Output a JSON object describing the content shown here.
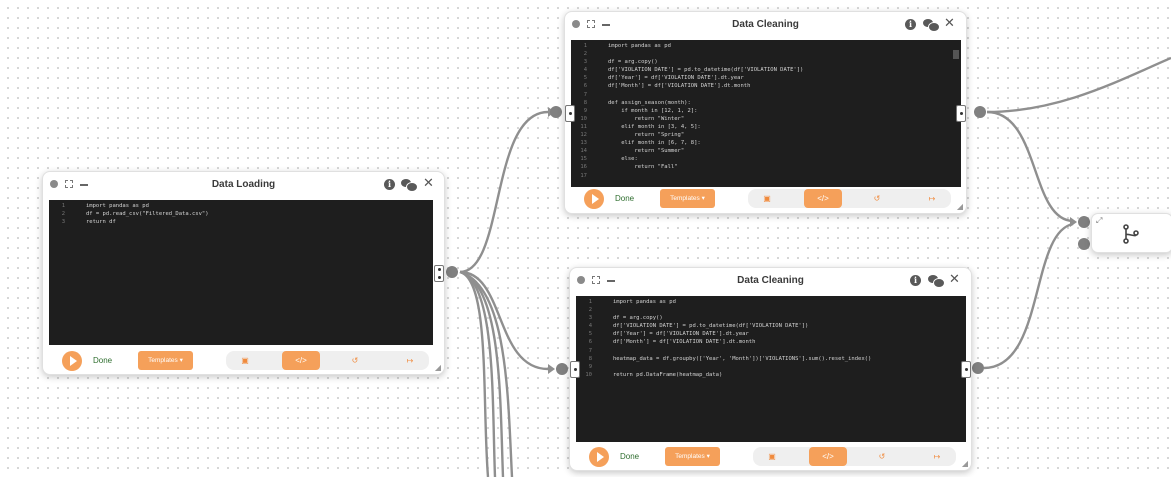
{
  "colors": {
    "accent": "#f5a05a",
    "status_done": "#2f6e2f",
    "editor_bg": "#1e1e1e"
  },
  "node_loading": {
    "title": "Data Loading",
    "status": "Done",
    "templates_label": "Templates ▾",
    "code": [
      {
        "n": "1",
        "t": "import pandas as pd"
      },
      {
        "n": "2",
        "t": "df = pd.read_csv(\"Filtered_Data.csv\")"
      },
      {
        "n": "3",
        "t": "return df"
      }
    ]
  },
  "node_cleaning_1": {
    "title": "Data Cleaning",
    "status": "Done",
    "templates_label": "Templates ▾",
    "code": [
      {
        "n": "1",
        "t": "import pandas as pd"
      },
      {
        "n": "2",
        "t": ""
      },
      {
        "n": "3",
        "t": "df = arg.copy()"
      },
      {
        "n": "4",
        "t": "df['VIOLATION DATE'] = pd.to_datetime(df['VIOLATION DATE'])"
      },
      {
        "n": "5",
        "t": "df['Year'] = df['VIOLATION DATE'].dt.year"
      },
      {
        "n": "6",
        "t": "df['Month'] = df['VIOLATION DATE'].dt.month"
      },
      {
        "n": "7",
        "t": ""
      },
      {
        "n": "8",
        "t": "def assign_season(month):"
      },
      {
        "n": "9",
        "t": "    if month in [12, 1, 2]:"
      },
      {
        "n": "10",
        "t": "        return \"Winter\""
      },
      {
        "n": "11",
        "t": "    elif month in [3, 4, 5]:"
      },
      {
        "n": "12",
        "t": "        return \"Spring\""
      },
      {
        "n": "13",
        "t": "    elif month in [6, 7, 8]:"
      },
      {
        "n": "14",
        "t": "        return \"Summer\""
      },
      {
        "n": "15",
        "t": "    else:"
      },
      {
        "n": "16",
        "t": "        return \"Fall\""
      },
      {
        "n": "17",
        "t": ""
      }
    ]
  },
  "node_cleaning_2": {
    "title": "Data Cleaning",
    "status": "Done",
    "templates_label": "Templates ▾",
    "code": [
      {
        "n": "1",
        "t": "import pandas as pd"
      },
      {
        "n": "2",
        "t": ""
      },
      {
        "n": "3",
        "t": "df = arg.copy()"
      },
      {
        "n": "4",
        "t": "df['VIOLATION DATE'] = pd.to_datetime(df['VIOLATION DATE'])"
      },
      {
        "n": "5",
        "t": "df['Year'] = df['VIOLATION DATE'].dt.year"
      },
      {
        "n": "6",
        "t": "df['Month'] = df['VIOLATION DATE'].dt.month"
      },
      {
        "n": "7",
        "t": ""
      },
      {
        "n": "8",
        "t": "heatmap_data = df.groupby(['Year', 'Month'])['VIOLATIONS'].sum().reset_index()"
      },
      {
        "n": "9",
        "t": ""
      },
      {
        "n": "10",
        "t": "return pd.DataFrame(heatmap_data)"
      }
    ]
  },
  "icons": {
    "info": "info-icon",
    "chat": "chat-icon",
    "close": "close-icon",
    "run": "play-icon",
    "toolbox": "toolbox-icon",
    "code": "code-icon",
    "undo": "undo-icon",
    "export": "export-icon",
    "merge": "merge-icon"
  },
  "glyphs": {
    "close": "✕",
    "info": "i",
    "code": "</>",
    "undo": "↺",
    "export": "↦",
    "toolbox": "▣",
    "resize": "◢",
    "expand": "⤢"
  }
}
